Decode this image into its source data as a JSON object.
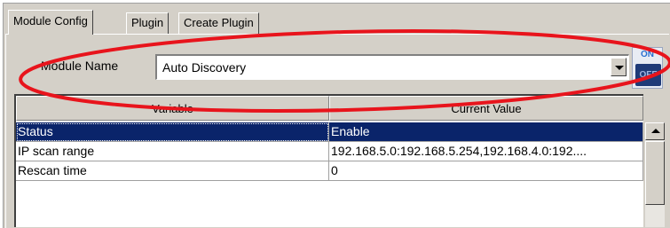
{
  "tabs": [
    {
      "label": "Module Config",
      "active": true
    },
    {
      "label": "Plugin",
      "active": false
    },
    {
      "label": "Create Plugin",
      "active": false
    }
  ],
  "module": {
    "label": "Module Name",
    "value": "Auto Discovery"
  },
  "toggle": {
    "on_label": "ON",
    "off_label": "OFF"
  },
  "grid": {
    "headers": [
      "Variable",
      "Current Value"
    ],
    "rows": [
      {
        "variable": "Status",
        "value": "Enable",
        "selected": true
      },
      {
        "variable": "IP scan range",
        "value": "192.168.5.0:192.168.5.254,192.168.4.0:192....",
        "selected": false
      },
      {
        "variable": "Rescan time",
        "value": "0",
        "selected": false
      }
    ]
  },
  "colors": {
    "selection": "#0a246a",
    "annotation": "#e8141c",
    "panel": "#d4d0c8"
  }
}
